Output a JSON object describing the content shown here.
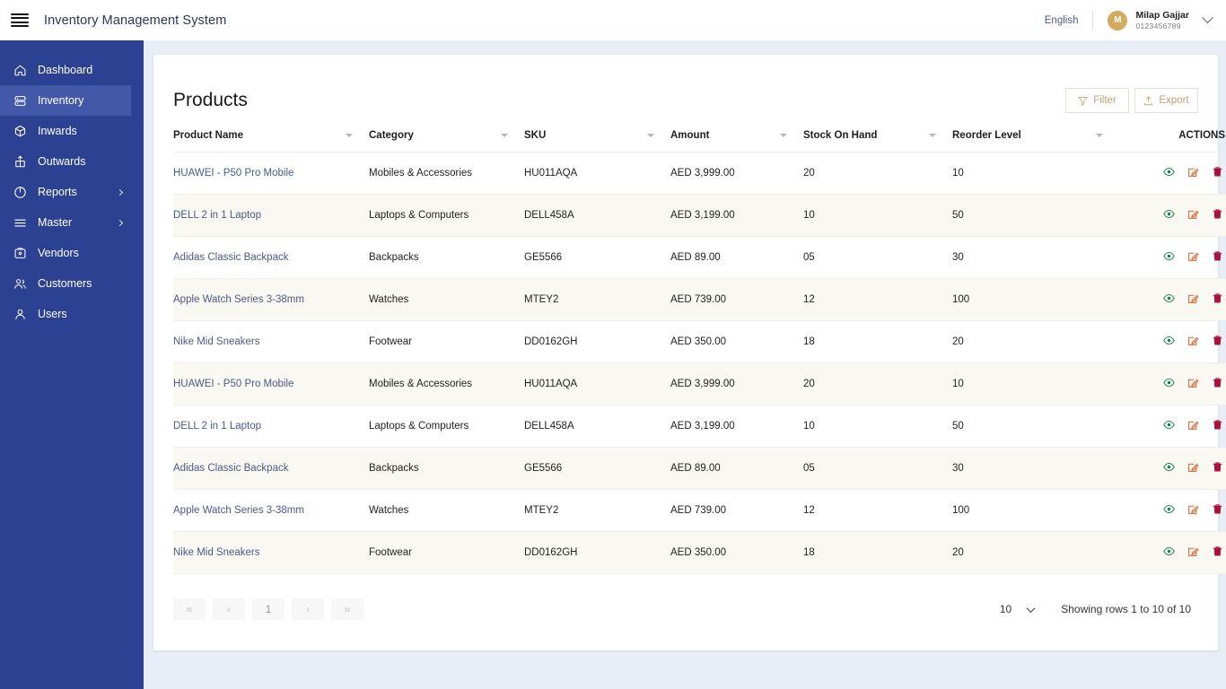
{
  "header": {
    "menu_icon": "hamburger-icon",
    "app_title": "Inventory Management System",
    "language": "English",
    "avatar_initial": "M",
    "avatar_color": "#d4ab5e",
    "user_name": "Milap Gajjar",
    "user_phone": "0123456789",
    "caret_icon": "chevron-down-icon"
  },
  "sidebar": {
    "bg_color": "#2c4191",
    "active_color": "#4358a8",
    "items": [
      {
        "label": "Dashboard",
        "icon": "home-icon",
        "active": false,
        "expandable": false
      },
      {
        "label": "Inventory",
        "icon": "database-icon",
        "active": true,
        "expandable": false
      },
      {
        "label": "Inwards",
        "icon": "inwards-icon",
        "active": false,
        "expandable": false
      },
      {
        "label": "Outwards",
        "icon": "outwards-icon",
        "active": false,
        "expandable": false
      },
      {
        "label": "Reports",
        "icon": "pie-chart-icon",
        "active": false,
        "expandable": true
      },
      {
        "label": "Master",
        "icon": "list-icon",
        "active": false,
        "expandable": true
      },
      {
        "label": "Vendors",
        "icon": "briefcase-icon",
        "active": false,
        "expandable": false
      },
      {
        "label": "Customers",
        "icon": "users-icon",
        "active": false,
        "expandable": false
      },
      {
        "label": "Users",
        "icon": "user-icon",
        "active": false,
        "expandable": false
      }
    ]
  },
  "main": {
    "page_title": "Products",
    "accent_color": "#b9a476",
    "buttons": [
      {
        "label": "Filter",
        "icon": "filter-icon"
      },
      {
        "label": "Export",
        "icon": "upload-icon"
      }
    ],
    "table": {
      "columns": [
        {
          "label": "Product Name",
          "sortable": true
        },
        {
          "label": "Category",
          "sortable": true
        },
        {
          "label": "SKU",
          "sortable": true
        },
        {
          "label": "Amount",
          "sortable": true
        },
        {
          "label": "Stock On Hand",
          "sortable": true
        },
        {
          "label": "Reorder Level",
          "sortable": true
        },
        {
          "label": "ACTIONS",
          "sortable": false
        }
      ],
      "row_actions": [
        {
          "name": "view-icon",
          "color": "#13824b"
        },
        {
          "name": "edit-icon",
          "color": "#d9622b"
        },
        {
          "name": "delete-icon",
          "color": "#a8123c"
        }
      ],
      "rows": [
        {
          "name": "HUAWEI - P50 Pro Mobile",
          "category": "Mobiles & Accessories",
          "sku": "HU011AQA",
          "amount": "AED 3,999.00",
          "stock_on_hand": "20",
          "reorder_level": "10"
        },
        {
          "name": "DELL 2 in 1 Laptop",
          "category": "Laptops & Computers",
          "sku": "DELL458A",
          "amount": "AED 3,199.00",
          "stock_on_hand": "10",
          "reorder_level": "50"
        },
        {
          "name": "Adidas Classic Backpack",
          "category": "Backpacks",
          "sku": "GE5566",
          "amount": "AED 89.00",
          "stock_on_hand": "05",
          "reorder_level": "30"
        },
        {
          "name": "Apple Watch Series 3-38mm",
          "category": "Watches",
          "sku": "MTEY2",
          "amount": "AED 739.00",
          "stock_on_hand": "12",
          "reorder_level": "100"
        },
        {
          "name": "Nike Mid Sneakers",
          "category": "Footwear",
          "sku": "DD0162GH",
          "amount": "AED 350.00",
          "stock_on_hand": "18",
          "reorder_level": "20"
        },
        {
          "name": "HUAWEI - P50 Pro Mobile",
          "category": "Mobiles & Accessories",
          "sku": "HU011AQA",
          "amount": "AED 3,999.00",
          "stock_on_hand": "20",
          "reorder_level": "10"
        },
        {
          "name": "DELL 2 in 1 Laptop",
          "category": "Laptops & Computers",
          "sku": "DELL458A",
          "amount": "AED 3,199.00",
          "stock_on_hand": "10",
          "reorder_level": "50"
        },
        {
          "name": "Adidas Classic Backpack",
          "category": "Backpacks",
          "sku": "GE5566",
          "amount": "AED 89.00",
          "stock_on_hand": "05",
          "reorder_level": "30"
        },
        {
          "name": "Apple Watch Series 3-38mm",
          "category": "Watches",
          "sku": "MTEY2",
          "amount": "AED 739.00",
          "stock_on_hand": "12",
          "reorder_level": "100"
        },
        {
          "name": "Nike Mid Sneakers",
          "category": "Footwear",
          "sku": "DD0162GH",
          "amount": "AED 350.00",
          "stock_on_hand": "18",
          "reorder_level": "20"
        }
      ]
    },
    "pagination": {
      "buttons": [
        "«",
        "‹",
        "1",
        "›",
        "»"
      ],
      "current_page": "1",
      "rows_per_page": "10",
      "showing_text": "Showing rows 1 to 10 of 10"
    }
  }
}
